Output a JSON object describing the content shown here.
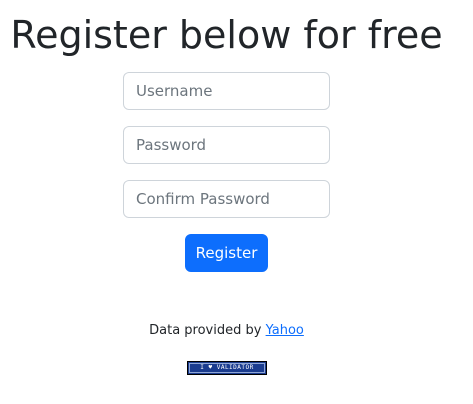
{
  "page": {
    "title": "Register below for free"
  },
  "form": {
    "username_placeholder": "Username",
    "password_placeholder": "Password",
    "confirm_password_placeholder": "Confirm Password",
    "submit_label": "Register"
  },
  "footer": {
    "credit_prefix": "Data provided by ",
    "credit_link": "Yahoo",
    "badge_text": "I ♥ VALIDATOR"
  },
  "colors": {
    "primary": "#0d6efd",
    "text": "#212529",
    "placeholder": "#6c757d",
    "border": "#ced4da",
    "badge_bg": "#1b3c8f"
  }
}
